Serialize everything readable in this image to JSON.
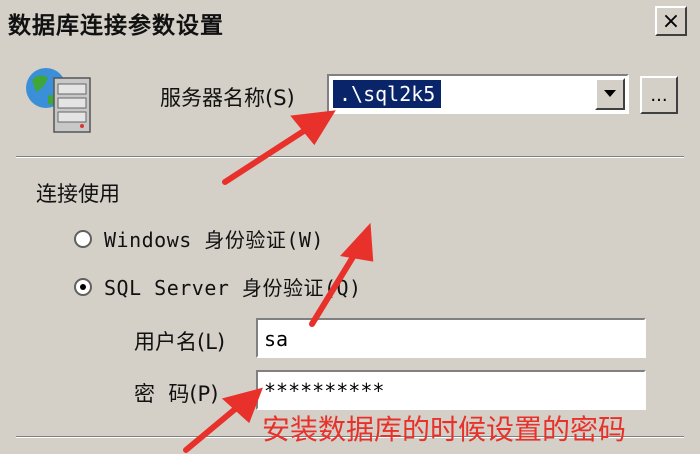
{
  "window": {
    "title": "数据库连接参数设置",
    "close_label": "×"
  },
  "server": {
    "label": "服务器名称(S)",
    "value": ".\\sql2k5",
    "browse_label": "..."
  },
  "connection": {
    "group_label": "连接使用",
    "options": [
      {
        "label": "Windows 身份验证(W)",
        "selected": false
      },
      {
        "label": "SQL Server 身份验证(Q)",
        "selected": true
      }
    ]
  },
  "credentials": {
    "username_label": "用户名(L)",
    "username_value": "sa",
    "password_label": "密  码(P)",
    "password_value": "**********"
  },
  "annotation": {
    "text": "安装数据库的时候设置的密码",
    "color": "#e8312a"
  },
  "icons": {
    "server": "database-server-icon",
    "dropdown": "chevron-down-icon"
  }
}
